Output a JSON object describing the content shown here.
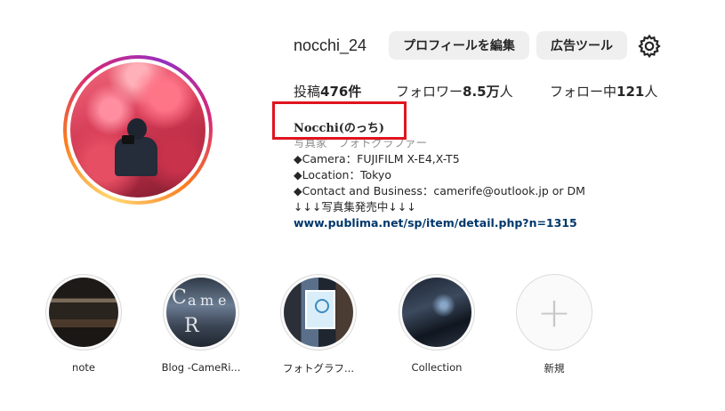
{
  "profile": {
    "username": "nocchi_24",
    "edit_profile_label": "プロフィールを編集",
    "ad_tools_label": "広告ツール",
    "settings_icon": "gear-icon"
  },
  "stats": {
    "posts_prefix": "投稿",
    "posts_count": "476件",
    "followers_prefix": "フォロワー",
    "followers_count": "8.5万",
    "followers_suffix": "人",
    "following_prefix": "フォロー中",
    "following_count": "121",
    "following_suffix": "人"
  },
  "bio": {
    "name": "Nocchi(のっち)",
    "category": "写真家　フォトグラファー",
    "line1": "◆Camera：FUJIFILM X-E4,X-T5",
    "line2": "◆Location：Tokyo",
    "line3": "◆Contact and Business：camerife@outlook.jp or DM",
    "line4": "↓↓↓写真集発売中↓↓↓",
    "link": "www.publima.net/sp/item/detail.php?n=1315"
  },
  "highlights": [
    {
      "label": "note"
    },
    {
      "label": "Blog -CameRi..."
    },
    {
      "label": "フォトグラフ..."
    },
    {
      "label": "Collection"
    },
    {
      "label": "新規"
    }
  ],
  "colors": {
    "annotation_box": "#e0141e",
    "link": "#00376b",
    "button_bg": "#efefef"
  }
}
